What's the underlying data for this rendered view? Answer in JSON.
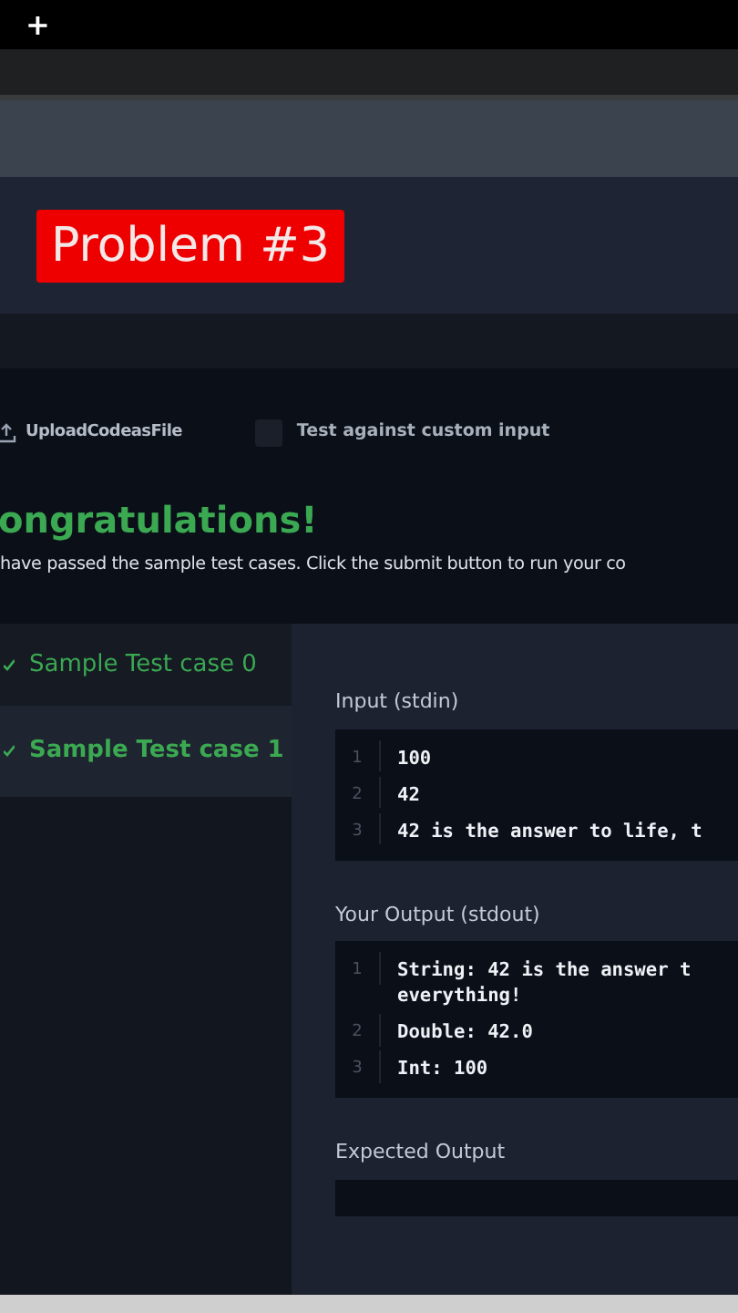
{
  "browser": {
    "new_tab": "+"
  },
  "badge": "Problem #3",
  "toolbar": {
    "upload": "UploadCodeasFile",
    "custom_input": {
      "label": "Test against custom input",
      "checked": false
    }
  },
  "result": {
    "title": "ongratulations!",
    "message": "have passed the sample test cases. Click the submit button to run your co"
  },
  "test_cases": [
    {
      "label": "Sample Test case 0",
      "selected": false
    },
    {
      "label": "Sample Test case 1",
      "selected": true
    }
  ],
  "sections": [
    {
      "title": "Input (stdin)",
      "lines": [
        {
          "num": "1",
          "text": "100"
        },
        {
          "num": "2",
          "text": "42"
        },
        {
          "num": "3",
          "text": "42 is the answer to life, t"
        }
      ]
    },
    {
      "title": "Your Output (stdout)",
      "lines": [
        {
          "num": "1",
          "text": "String: 42 is the answer t",
          "cont": "everything!"
        },
        {
          "num": "2",
          "text": "Double: 42.0"
        },
        {
          "num": "3",
          "text": "Int: 100"
        }
      ]
    },
    {
      "title": "Expected Output"
    }
  ]
}
